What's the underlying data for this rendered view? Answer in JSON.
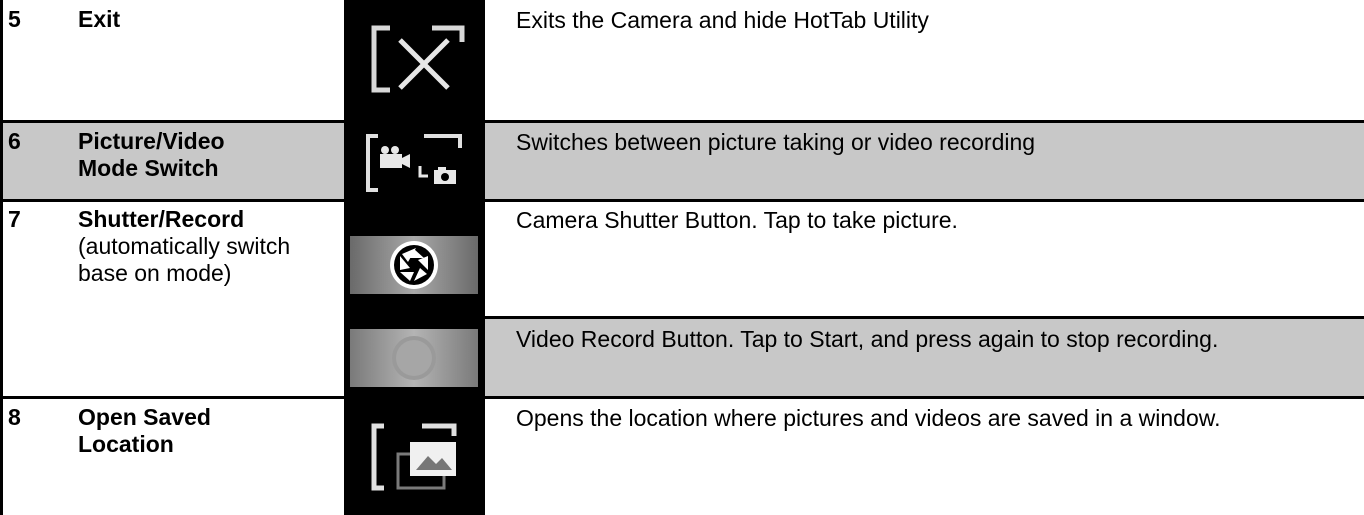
{
  "rows": [
    {
      "number": "5",
      "name": "Exit",
      "icon": "exit-x-icon",
      "description": "Exits the Camera and hide HotTab Utility"
    },
    {
      "number": "6",
      "name_line1": "Picture/Video",
      "name_line2": "Mode Switch",
      "icon": "mode-switch-icon",
      "description": "Switches between picture taking or video recording"
    },
    {
      "number": "7",
      "name": "Shutter/Record",
      "name_note": "(automatically switch base on mode)",
      "icon_shutter": "aperture-shutter-icon",
      "icon_record": "record-button-icon",
      "description_shutter": "Camera Shutter Button. Tap to take picture.",
      "description_record": "Video Record Button. Tap to Start, and press again to stop recording."
    },
    {
      "number": "8",
      "name_line1": "Open Saved",
      "name_line2": "Location",
      "icon": "open-folder-picture-icon",
      "description": "Opens the location where pictures and videos are saved in a window."
    }
  ],
  "colors": {
    "row_shade": "#c8c8c8",
    "icon_bg": "#000000",
    "rule": "#000000"
  }
}
